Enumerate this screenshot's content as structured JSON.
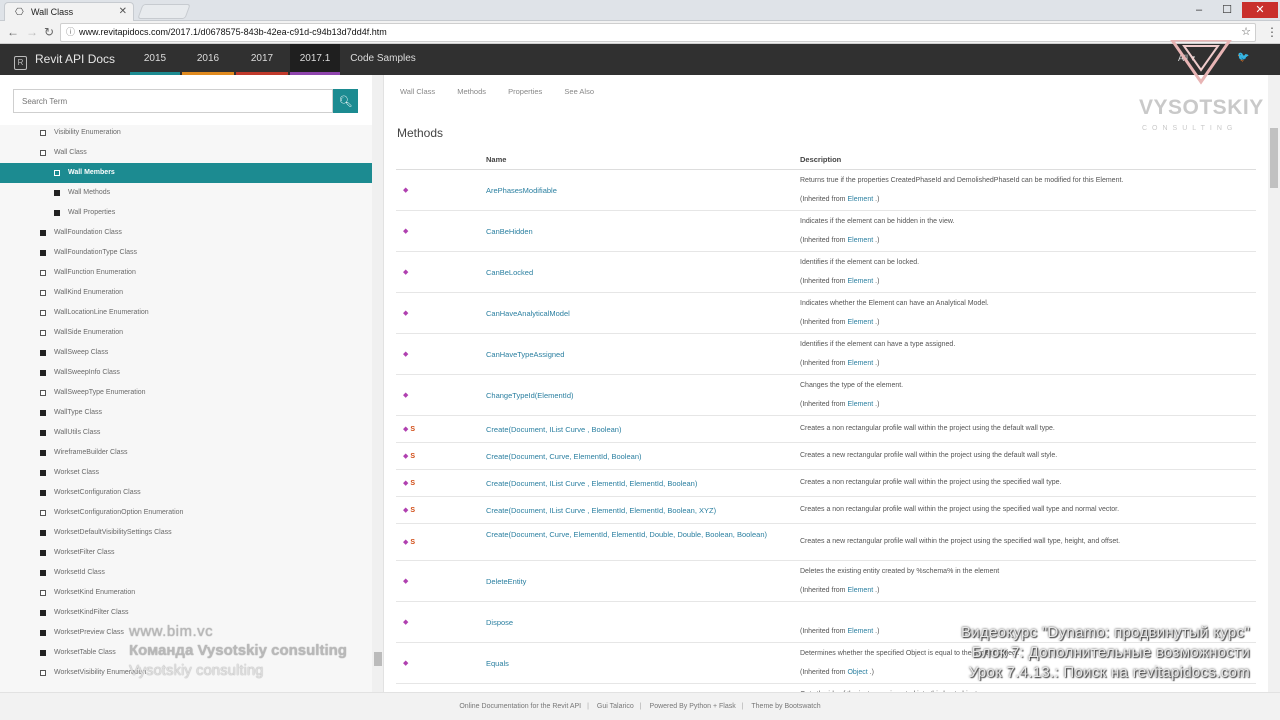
{
  "browser": {
    "tab_title": "Wall Class",
    "url": "www.revitapidocs.com/2017.1/d0678575-843b-42ea-c91d-c94b13d7dd4f.htm"
  },
  "navbar": {
    "brand": "Revit API Docs",
    "versions": [
      {
        "label": "2015",
        "color": "#1c8b91"
      },
      {
        "label": "2016",
        "color": "#e08a1e"
      },
      {
        "label": "2017",
        "color": "#c0392b"
      },
      {
        "label": "2017.1",
        "color": "#8e44ad"
      },
      {
        "label": "Code Samples",
        "color": ""
      }
    ],
    "all_label": "All"
  },
  "sidebar": {
    "search_placeholder": "Search Term",
    "items": [
      {
        "label": "Visibility Enumeration",
        "bullet": "hollow",
        "level": 1
      },
      {
        "label": "Wall Class",
        "bullet": "hollow",
        "level": 1
      },
      {
        "label": "Wall Members",
        "bullet": "hollow",
        "level": 2,
        "active": true
      },
      {
        "label": "Wall Methods",
        "bullet": "filled",
        "level": 2
      },
      {
        "label": "Wall Properties",
        "bullet": "filled",
        "level": 2
      },
      {
        "label": "WallFoundation Class",
        "bullet": "filled",
        "level": 1
      },
      {
        "label": "WallFoundationType Class",
        "bullet": "filled",
        "level": 1
      },
      {
        "label": "WallFunction Enumeration",
        "bullet": "hollow",
        "level": 1
      },
      {
        "label": "WallKind Enumeration",
        "bullet": "hollow",
        "level": 1
      },
      {
        "label": "WallLocationLine Enumeration",
        "bullet": "hollow",
        "level": 1
      },
      {
        "label": "WallSide Enumeration",
        "bullet": "hollow",
        "level": 1
      },
      {
        "label": "WallSweep Class",
        "bullet": "filled",
        "level": 1
      },
      {
        "label": "WallSweepInfo Class",
        "bullet": "filled",
        "level": 1
      },
      {
        "label": "WallSweepType Enumeration",
        "bullet": "hollow",
        "level": 1
      },
      {
        "label": "WallType Class",
        "bullet": "filled",
        "level": 1
      },
      {
        "label": "WallUtils Class",
        "bullet": "filled",
        "level": 1
      },
      {
        "label": "WireframeBuilder Class",
        "bullet": "filled",
        "level": 1
      },
      {
        "label": "Workset Class",
        "bullet": "filled",
        "level": 1
      },
      {
        "label": "WorksetConfiguration Class",
        "bullet": "filled",
        "level": 1
      },
      {
        "label": "WorksetConfigurationOption Enumeration",
        "bullet": "hollow",
        "level": 1
      },
      {
        "label": "WorksetDefaultVisibilitySettings Class",
        "bullet": "filled",
        "level": 1
      },
      {
        "label": "WorksetFilter Class",
        "bullet": "filled",
        "level": 1
      },
      {
        "label": "WorksetId Class",
        "bullet": "filled",
        "level": 1
      },
      {
        "label": "WorksetKind Enumeration",
        "bullet": "hollow",
        "level": 1
      },
      {
        "label": "WorksetKindFilter Class",
        "bullet": "filled",
        "level": 1
      },
      {
        "label": "WorksetPreview Class",
        "bullet": "filled",
        "level": 1
      },
      {
        "label": "WorksetTable Class",
        "bullet": "filled",
        "level": 1
      },
      {
        "label": "WorksetVisibility Enumeration",
        "bullet": "hollow",
        "level": 1
      }
    ]
  },
  "content": {
    "breadcrumbs": [
      "Wall Class",
      "Methods",
      "Properties",
      "See Also"
    ],
    "heading": "Methods",
    "col_name": "Name",
    "col_desc": "Description",
    "inherited_prefix": "(Inherited from",
    "inherited_suffix": ".)",
    "rows": [
      {
        "name": "ArePhasesModifiable",
        "desc": "Returns true if the properties CreatedPhaseId and DemolishedPhaseId can be modified for this Element.",
        "inherited": "Element",
        "static": false
      },
      {
        "name": "CanBeHidden",
        "desc": "Indicates if the element can be hidden in the view.",
        "inherited": "Element",
        "static": false
      },
      {
        "name": "CanBeLocked",
        "desc": "Identifies if the element can be locked.",
        "inherited": "Element",
        "static": false
      },
      {
        "name": "CanHaveAnalyticalModel",
        "desc": "Indicates whether the Element can have an Analytical Model.",
        "inherited": "Element",
        "static": false
      },
      {
        "name": "CanHaveTypeAssigned",
        "desc": "Identifies if the element can have a type assigned.",
        "inherited": "Element",
        "static": false
      },
      {
        "name": "ChangeTypeId(ElementId)",
        "desc": "Changes the type of the element.",
        "inherited": "Element",
        "static": false
      },
      {
        "name": "Create(Document, IList Curve , Boolean)",
        "desc": "Creates a non rectangular profile wall within the project using the default wall type.",
        "inherited": "",
        "static": true
      },
      {
        "name": "Create(Document, Curve, ElementId, Boolean)",
        "desc": "Creates a new rectangular profile wall within the project using the default wall style.",
        "inherited": "",
        "static": true
      },
      {
        "name": "Create(Document, IList Curve , ElementId, ElementId, Boolean)",
        "desc": "Creates a non rectangular profile wall within the project using the specified wall type.",
        "inherited": "",
        "static": true
      },
      {
        "name": "Create(Document, IList Curve , ElementId, ElementId, Boolean, XYZ)",
        "desc": "Creates a non rectangular profile wall within the project using the specified wall type and normal vector.",
        "inherited": "",
        "static": true
      },
      {
        "name": "Create(Document, Curve, ElementId, ElementId, Double, Double, Boolean, Boolean)",
        "desc": "Creates a new rectangular profile wall within the project using the specified wall type, height, and offset.",
        "inherited": "",
        "static": true
      },
      {
        "name": "DeleteEntity",
        "desc": "Deletes the existing entity created by %schema% in the element",
        "inherited": "Element",
        "static": false
      },
      {
        "name": "Dispose",
        "desc": "",
        "inherited": "Element",
        "static": false
      },
      {
        "name": "Equals",
        "desc": "Determines whether the specified Object is equal to the current Object.",
        "inherited": "Object",
        "static": false
      },
      {
        "name": "FindInserts",
        "desc": "Gets the ids of the instances inserted into this host object.",
        "inherited": "HostObject",
        "static": false
      }
    ]
  },
  "footer": [
    "Online Documentation for the Revit API",
    "Gui Talarico",
    "Powered By Python + Flask",
    "Theme by Bootswatch"
  ],
  "watermark": {
    "name": "VYSOTSKIY",
    "sub": "CONSULTING"
  },
  "overlay_left": [
    "www.bim.vc",
    "Команда Vysotskiy consulting",
    "Vysotskiy consulting"
  ],
  "overlay_right": [
    "Видеокурс \"Dynamo: продвинутый курс\"",
    "Блок 7: Дополнительные возможности",
    "Урок 7.4.13.: Поиск на revitapidocs.com"
  ]
}
